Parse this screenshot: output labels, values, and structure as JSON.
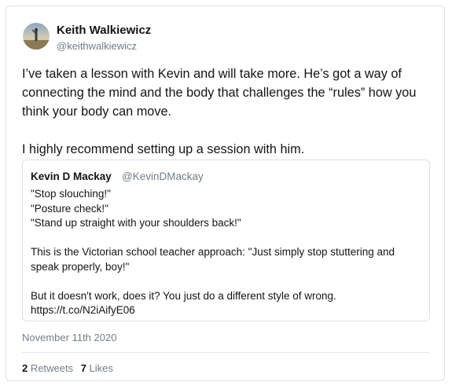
{
  "author": {
    "name": "Keith Walkiewicz",
    "handle": "@keithwalkiewicz"
  },
  "tweet": {
    "text": "I’ve taken a lesson with Kevin and will take more. He’s got a way of\nconnecting the mind and the body that challenges the “rules” how you\nthink your body can move.\n\nI highly recommend setting up a session with him."
  },
  "quoted": {
    "name": "Kevin D Mackay",
    "handle": "@KevinDMackay",
    "text": "\"Stop slouching!\"\n\"Posture check!\"\n\"Stand up straight with your shoulders back!\"\n\nThis is the Victorian school teacher approach: \"Just simply stop stuttering and\nspeak properly, boy!\"\n\nBut it doesn't work, does it? You just do a different style of wrong.\nhttps://t.co/N2iAifyE06"
  },
  "date": "November 11th 2020",
  "stats": {
    "retweets_count": "2",
    "retweets_label": "Retweets",
    "likes_count": "7",
    "likes_label": "Likes"
  }
}
